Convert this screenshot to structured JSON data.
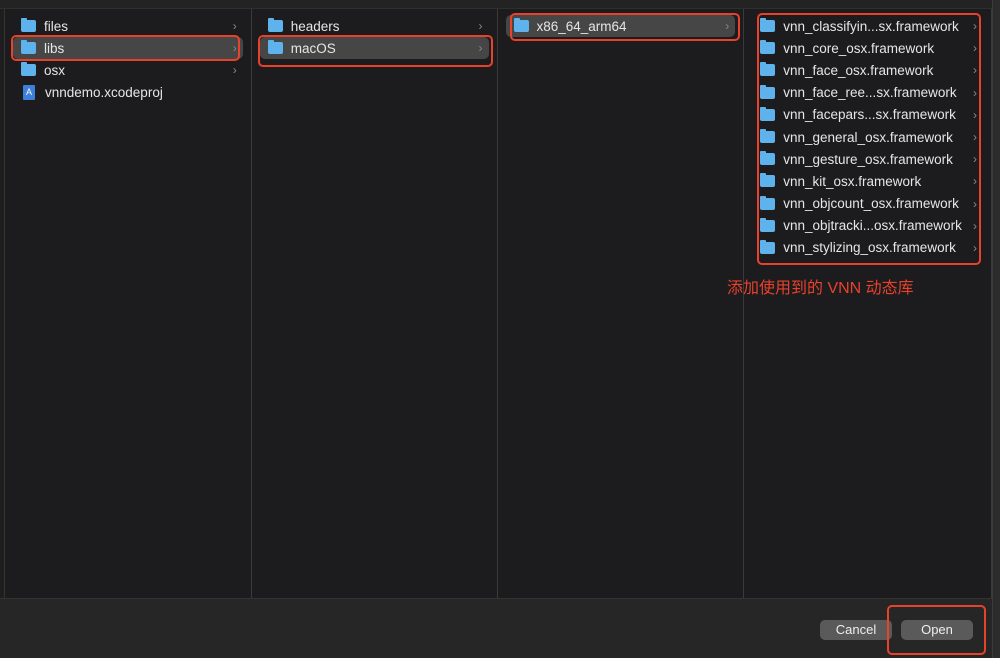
{
  "columns": [
    {
      "items": [
        {
          "name": "files",
          "type": "folder"
        },
        {
          "name": "libs",
          "type": "folder",
          "selected": true
        },
        {
          "name": "osx",
          "type": "folder"
        },
        {
          "name": "vnndemo.xcodeproj",
          "type": "file"
        }
      ]
    },
    {
      "items": [
        {
          "name": "headers",
          "type": "folder"
        },
        {
          "name": "macOS",
          "type": "folder",
          "selected": true
        }
      ]
    },
    {
      "items": [
        {
          "name": "x86_64_arm64",
          "type": "folder",
          "selected": true
        }
      ]
    },
    {
      "items": [
        {
          "name": "vnn_classifyin...sx.framework"
        },
        {
          "name": "vnn_core_osx.framework"
        },
        {
          "name": "vnn_face_osx.framework"
        },
        {
          "name": "vnn_face_ree...sx.framework"
        },
        {
          "name": "vnn_facepars...sx.framework"
        },
        {
          "name": "vnn_general_osx.framework"
        },
        {
          "name": "vnn_gesture_osx.framework"
        },
        {
          "name": "vnn_kit_osx.framework"
        },
        {
          "name": "vnn_objcount_osx.framework"
        },
        {
          "name": "vnn_objtracki...osx.framework"
        },
        {
          "name": "vnn_stylizing_osx.framework"
        }
      ]
    }
  ],
  "annotation": "添加使用到的 VNN 动态库",
  "buttons": {
    "cancel": "Cancel",
    "open": "Open"
  },
  "colors": {
    "highlight": "#e8412c",
    "folder": "#5eb3ec"
  }
}
